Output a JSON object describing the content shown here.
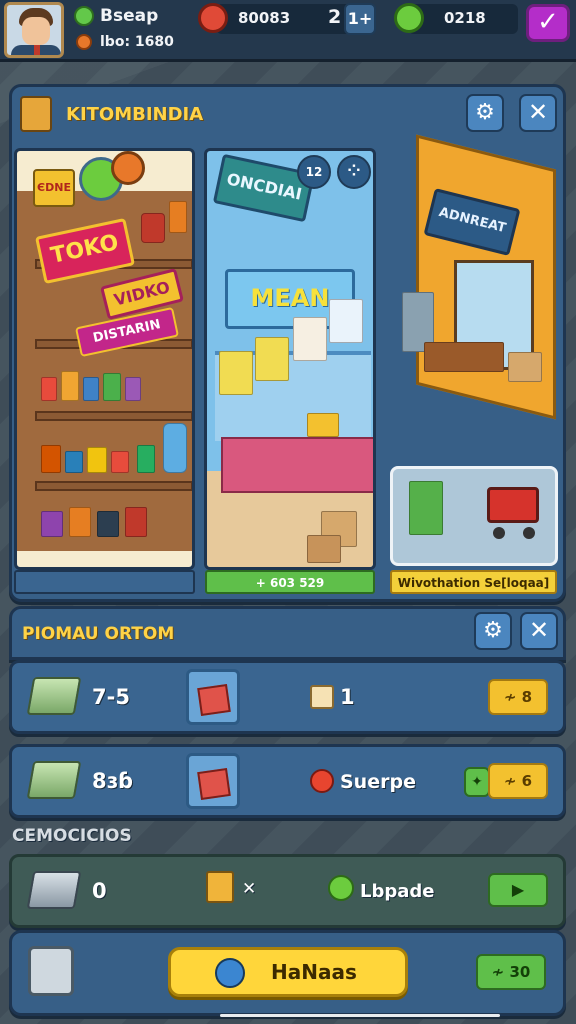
{
  "top_bar": {
    "player_name": "Bseap",
    "player_sub": "lbo: 1680",
    "coins_label": "80083",
    "coins_value": "2",
    "coins_btn": "1+",
    "gems_value": "0218"
  },
  "store_panel": {
    "title": "KITOMBINDIA",
    "cards": [
      {
        "sign_main": "TOKO",
        "sign_top": "ЄDNE",
        "sign_mid": "VIDKO",
        "sign_low": "DISTARIN"
      },
      {
        "sign_main": "ONCDIAI",
        "sign_mid": "MEAN",
        "badge": "12",
        "price_bar": "+ 603 529"
      },
      {
        "sign_main": "ADNREAT",
        "caption_bar": "Wivothation Se[loqaa]"
      }
    ]
  },
  "orders_panel": {
    "title": "PIOMAU ORTOM",
    "rows": [
      {
        "amount": "7-5",
        "item_count": "1",
        "button": "≁ 8"
      },
      {
        "amount": "8ɜɓ",
        "item_label": "Suerpe",
        "button": "≁ 6"
      }
    ]
  },
  "section_label": "CEMOCICIOS",
  "extra_row": {
    "amount": "0",
    "x_label": "✕",
    "item_label": "Lbpade"
  },
  "bottom_bar": {
    "main_button": "HaNaas",
    "side_value": "≁ 30"
  },
  "colors": {
    "panel": "#375f87",
    "accent_yellow": "#ffd347",
    "green": "#5fbf4a",
    "purple": "#b42dc9"
  }
}
